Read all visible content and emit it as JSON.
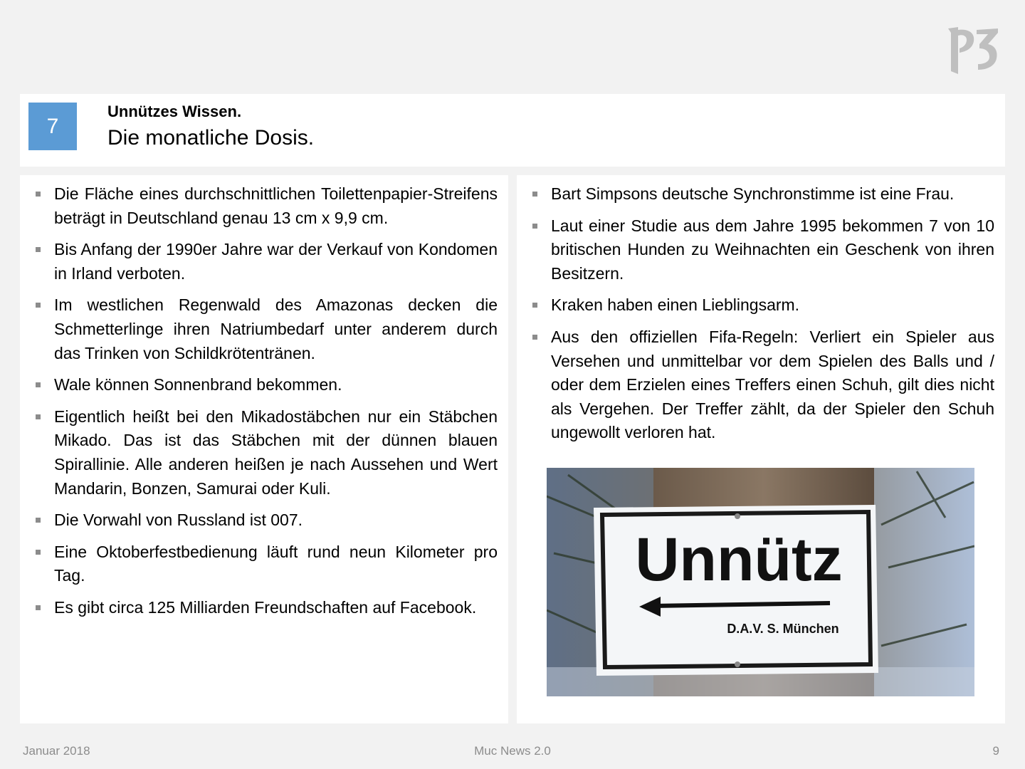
{
  "logo": {
    "icon": "p3-logo-icon",
    "text": "P3"
  },
  "header": {
    "number": "7",
    "kicker": "Unnützes Wissen.",
    "title": "Die monatliche Dosis."
  },
  "left_facts": [
    "Die Fläche eines durchschnittlichen Toilettenpapier-Streifens beträgt in Deutschland genau 13 cm x 9,9 cm.",
    "Bis Anfang der 1990er Jahre war der Verkauf von Kondomen in Irland verboten.",
    "Im westlichen Regenwald des Amazonas decken die Schmetterlinge ihren Natriumbedarf unter anderem durch das Trinken von Schildkrötentränen.",
    "Wale können Sonnenbrand bekommen.",
    "Eigentlich heißt bei den Mikadostäbchen nur ein Stäbchen Mikado. Das ist das Stäbchen mit der dünnen blauen Spirallinie. Alle anderen heißen je nach Aussehen und Wert Mandarin, Bonzen, Samurai oder Kuli.",
    "Die Vorwahl von Russland ist 007.",
    "Eine Oktoberfestbedienung läuft rund neun Kilometer pro Tag.",
    "Es gibt circa 125 Milliarden Freundschaften auf Facebook."
  ],
  "right_facts": [
    "Bart Simpsons deutsche Synchronstimme ist eine Frau.",
    "Laut einer Studie aus dem Jahre 1995 bekommen 7 von 10 britischen Hunden zu Weihnachten ein Geschenk von ihren Besitzern.",
    "Kraken haben einen Lieblingsarm.",
    "Aus den offiziellen Fifa-Regeln: Verliert ein Spieler aus Versehen und unmittelbar vor dem Spielen des Balls und / oder dem Erzielen eines Treffers einen Schuh, gilt dies nicht als Vergehen. Der Treffer zählt, da der Spieler den Schuh ungewollt verloren hat."
  ],
  "photo": {
    "sign_word": "Unnütz",
    "sign_small": "D.A.V. S. München"
  },
  "footer": {
    "date": "Januar 2018",
    "center": "Muc News 2.0",
    "page": "9"
  }
}
